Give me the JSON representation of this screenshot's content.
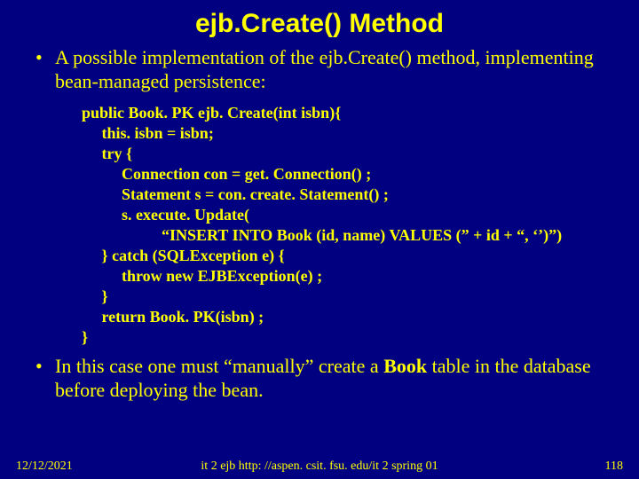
{
  "title": "ejb.Create() Method",
  "bullets": {
    "item1": "A possible implementation of the ejb.Create() method, implementing bean-managed persistence:",
    "item2_pre": "In this case one must “manually” create a ",
    "item2_bold": "Book",
    "item2_post": " table in the database before deploying the bean."
  },
  "code": "public Book. PK ejb. Create(int isbn){\n     this. isbn = isbn;\n     try {\n          Connection con = get. Connection() ;\n          Statement s = con. create. Statement() ;\n          s. execute. Update(\n                    “INSERT INTO Book (id, name) VALUES (” + id + “, ‘’)”)\n     } catch (SQLException e) {\n          throw new EJBException(e) ;\n     }\n     return Book. PK(isbn) ;\n}",
  "footer": {
    "date": "12/12/2021",
    "center": "it 2 ejb  http: //aspen. csit. fsu. edu/it 2 spring 01",
    "page": "118"
  }
}
